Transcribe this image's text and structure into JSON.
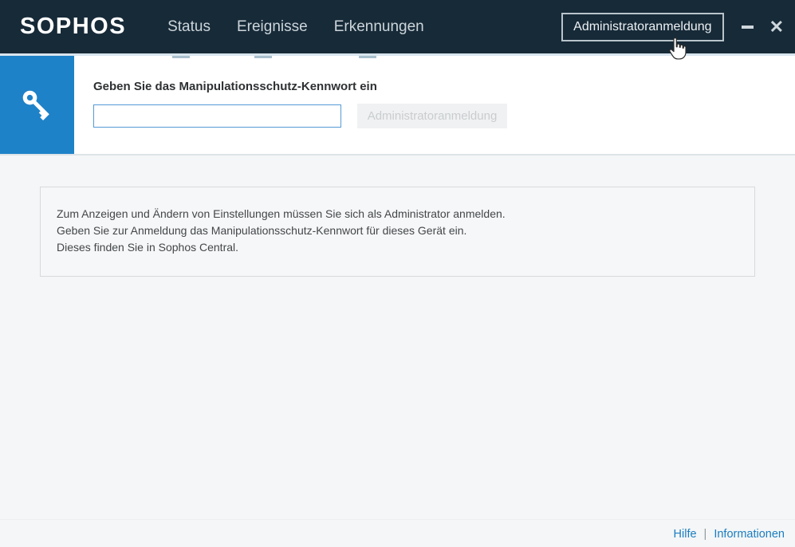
{
  "header": {
    "logo": "SOPHOS",
    "nav": [
      {
        "label": "Status"
      },
      {
        "label": "Ereignisse"
      },
      {
        "label": "Erkennungen"
      }
    ],
    "admin_button_label": "Administratoranmeldung"
  },
  "icons": {
    "minimize": "minimize-bar",
    "close": "✕",
    "key": "key-glyph",
    "cursor": "hand-pointer"
  },
  "login_panel": {
    "heading": "Geben Sie das Manipulationsschutz-Kennwort ein",
    "password_value": "",
    "password_placeholder": "",
    "submit_button_label": "Administratoranmeldung",
    "submit_enabled": false
  },
  "info_box": {
    "lines": [
      "Zum Anzeigen und Ändern von Einstellungen müssen Sie sich als Administrator anmelden.",
      "Geben Sie zur Anmeldung das Manipulationsschutz-Kennwort für dieses Gerät ein.",
      "Dieses finden Sie in Sophos Central."
    ]
  },
  "footer": {
    "help_label": "Hilfe",
    "separator": "|",
    "info_label": "Informationen"
  },
  "colors": {
    "header_bg": "#172a38",
    "accent_blue": "#1e82c8",
    "input_border": "#559bd6",
    "link_blue": "#1b7dc0",
    "page_bg": "#f4f6f7",
    "disabled_button_bg": "#f0f1f2"
  }
}
